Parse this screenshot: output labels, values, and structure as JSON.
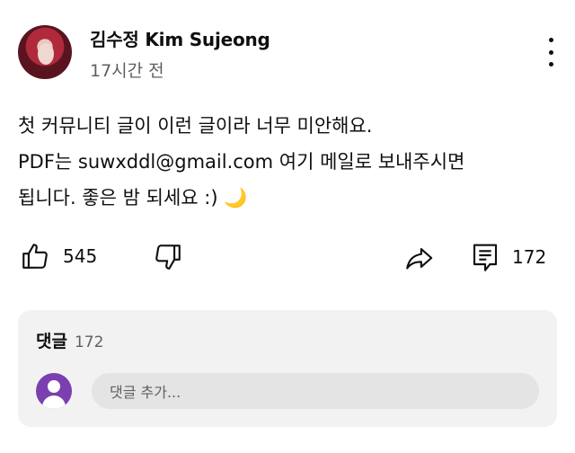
{
  "post": {
    "author": "김수정 Kim Sujeong",
    "time": "17시간 전",
    "lines": [
      "첫 커뮤니티 글이 이런 글이라 너무 미안해요.",
      "PDF는 suwxddl@gmail.com 여기 메일로 보내주시면",
      "됩니다. 좋은 밤 되세요 :) 🌙"
    ]
  },
  "actions": {
    "like_count": "545",
    "comment_count": "172"
  },
  "comments": {
    "title": "댓글",
    "count": "172",
    "input_placeholder": "댓글 추가..."
  },
  "colors": {
    "text": "#0f0f0f",
    "secondary": "#606060",
    "panel": "#f2f2f2",
    "user_avatar": "#7b3fb0"
  }
}
